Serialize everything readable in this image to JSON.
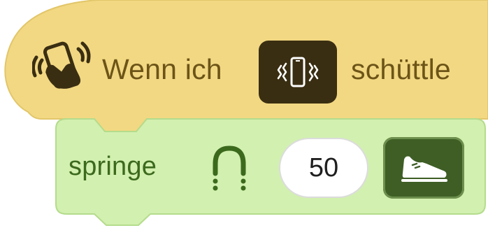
{
  "event_block": {
    "prefix_icon": "shake-phone-hand-icon",
    "label_before": "Wenn ich",
    "button_icon": "vibrating-phone-icon",
    "label_after": "schüttle",
    "colors": {
      "fill": "#f2d882",
      "text": "#6c5418",
      "button": "#3a2e12"
    }
  },
  "action_block": {
    "label": "springe",
    "jump_icon": "jump-arc-icon",
    "value": "50",
    "button_icon": "running-shoe-icon",
    "colors": {
      "fill": "#d2f0b0",
      "text": "#3c6a1d",
      "button": "#3e5e25"
    }
  }
}
